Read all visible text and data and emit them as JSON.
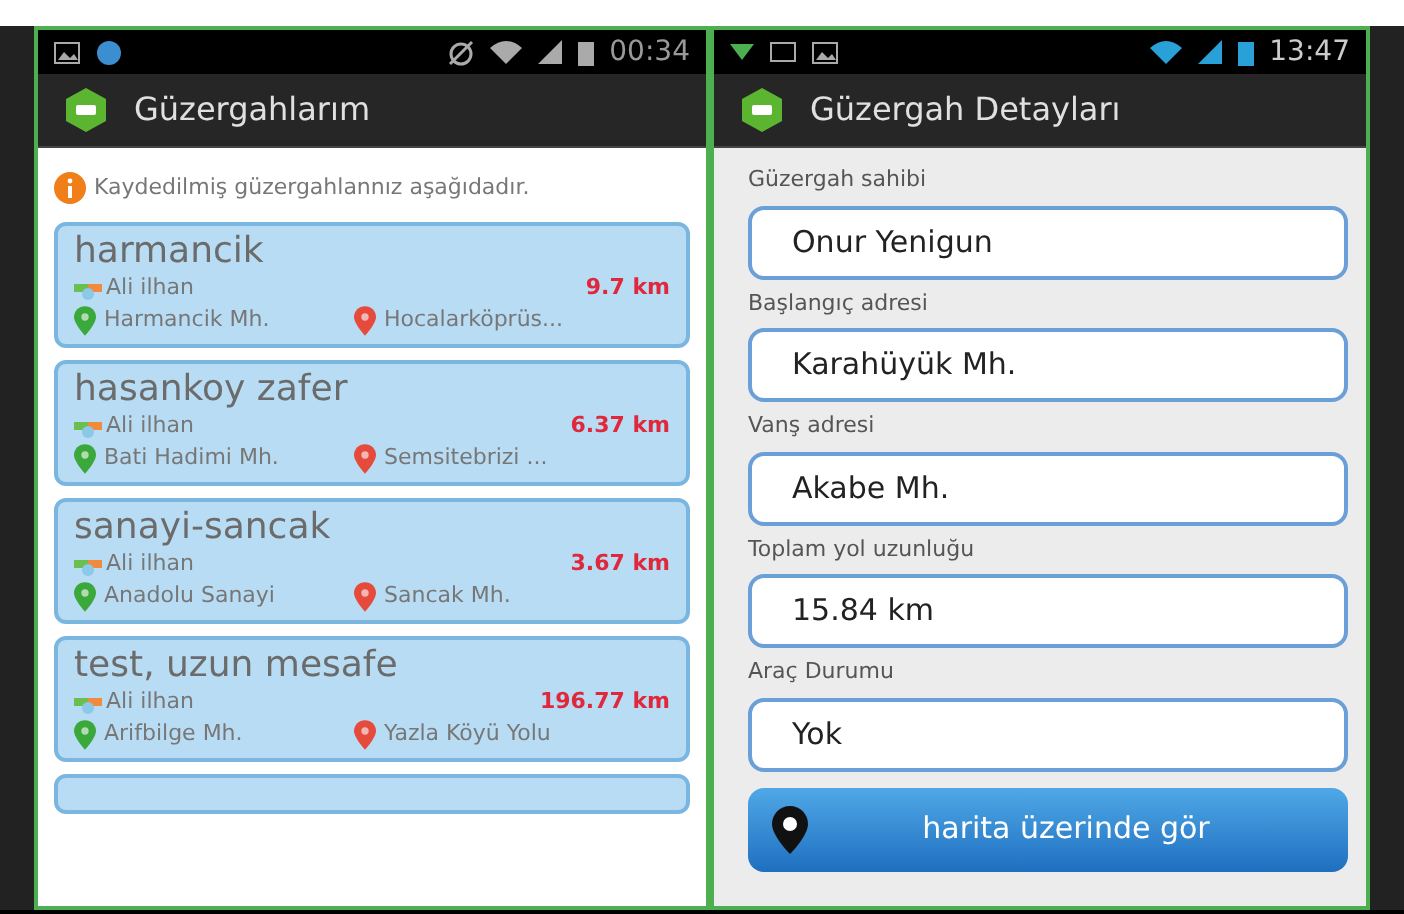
{
  "left_screen": {
    "status_bar": {
      "time": "00:34"
    },
    "title": "Güzergahlarım",
    "info": "Kaydedilmiş güzergahlannız aşağıdadır.",
    "routes": [
      {
        "name": "harmancik",
        "owner": "Ali ilhan",
        "distance": "9.7 km",
        "start": "Harmancik Mh.",
        "end": "Hocalarköprüs..."
      },
      {
        "name": "hasankoy zafer",
        "owner": "Ali ilhan",
        "distance": "6.37 km",
        "start": "Bati Hadimi Mh.",
        "end": "Semsitebrizi ..."
      },
      {
        "name": "sanayi-sancak",
        "owner": "Ali ilhan",
        "distance": "3.67 km",
        "start": "Anadolu Sanayi",
        "end": "Sancak Mh."
      },
      {
        "name": "test, uzun mesafe",
        "owner": "Ali ilhan",
        "distance": "196.77 km",
        "start": "Arifbilge Mh.",
        "end": "Yazla Köyü Yolu"
      }
    ]
  },
  "right_screen": {
    "status_bar": {
      "time": "13:47"
    },
    "title": "Güzergah Detayları",
    "fields": [
      {
        "label": "Güzergah sahibi",
        "value": "Onur Yenigun"
      },
      {
        "label": "Başlangıç adresi",
        "value": "Karahüyük Mh."
      },
      {
        "label": "Vanş adresi",
        "value": "Akabe Mh."
      },
      {
        "label": "Toplam yol uzunluğu",
        "value": "15.84 km"
      },
      {
        "label": "Araç Durumu",
        "value": "Yok"
      }
    ],
    "map_button": "harita üzerinde gör"
  }
}
